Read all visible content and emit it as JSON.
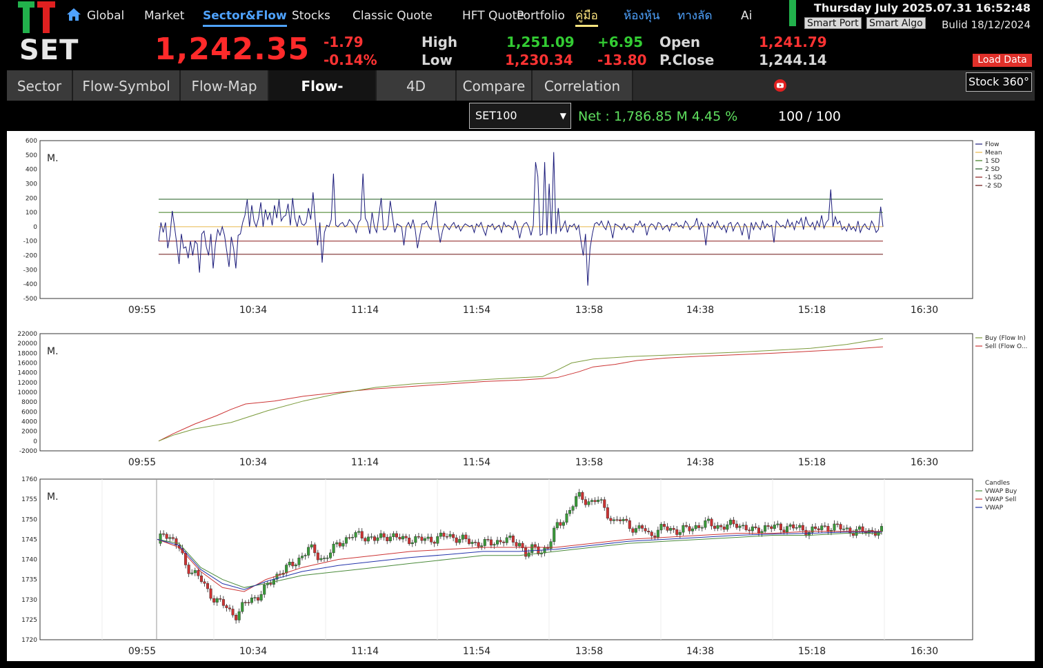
{
  "brand": {
    "tt": "TT",
    "set": "SET"
  },
  "nav": [
    {
      "label": "Global"
    },
    {
      "label": "Market"
    },
    {
      "label": "Sector&Flow"
    },
    {
      "label": "Stocks"
    },
    {
      "label": "Classic Quote"
    },
    {
      "label": "HFT Quote"
    },
    {
      "label": "Portfolio"
    },
    {
      "label": "คู่มือ"
    },
    {
      "label": "ห้องหุ้น"
    },
    {
      "label": "ทางลัด"
    },
    {
      "label": "Ai"
    }
  ],
  "header": {
    "datetime": "Thursday July 2025.07.31 16:52:48",
    "smart_port": "Smart Port",
    "smart_algo": "Smart Algo",
    "build": "Bulid 18/12/2024",
    "load_data": "Load Data"
  },
  "index": {
    "price": "1,242.35",
    "change": "-1.79",
    "change_pct": "-0.14%",
    "high_label": "High",
    "high": "1,251.09",
    "high_diff": "+6.95",
    "low_label": "Low",
    "low": "1,230.34",
    "low_diff": "-13.80",
    "open_label": "Open",
    "open": "1,241.79",
    "pclose_label": "P.Close",
    "pclose": "1,244.14"
  },
  "tabs": [
    {
      "label": "Sector"
    },
    {
      "label": "Flow-Symbol"
    },
    {
      "label": "Flow-Map"
    },
    {
      "label": "Flow-IntraDay"
    },
    {
      "label": "4D"
    },
    {
      "label": "Compare"
    },
    {
      "label": "Correlation"
    }
  ],
  "stock360": "Stock 360°",
  "filter": {
    "selected": "SET100",
    "net": "Net : 1,786.85 M",
    "net_pct": "4.45 %",
    "count": "100 / 100"
  },
  "colors": {
    "flow": "#1a1a7a",
    "mean": "#e8b84a",
    "sd1": "#3a7a1a",
    "sd2": "#1e5a1e",
    "neg_sd1": "#8a1a1a",
    "neg_sd2": "#6a1010",
    "buy": "#7a9a3a",
    "sell": "#cc3333",
    "vwap_buy": "#4a8a3a",
    "vwap_sell": "#cc3333",
    "vwap": "#2233aa",
    "candle_up": "#3a9a3a",
    "candle_down": "#cc3333"
  },
  "chart_data": [
    {
      "type": "line",
      "unit_label": "M.",
      "x_ticks": [
        "09:55",
        "10:34",
        "11:14",
        "11:54",
        "13:58",
        "14:38",
        "15:18",
        "16:30"
      ],
      "y_ticks": [
        600,
        500,
        400,
        300,
        200,
        100,
        0,
        -100,
        -200,
        -300,
        -400,
        -500
      ],
      "ylim": [
        -500,
        600
      ],
      "legend": [
        "Flow",
        "Mean",
        "1 SD",
        "2 SD",
        "-1 SD",
        "-2 SD"
      ],
      "legend_position": "right",
      "mean": 0,
      "sd1": 100,
      "sd2": 192,
      "neg_sd1": -100,
      "neg_sd2": -192,
      "flow_values": [
        -100,
        30,
        -40,
        30,
        -150,
        -60,
        110,
        0,
        -120,
        -260,
        -50,
        -150,
        -140,
        -220,
        -100,
        -200,
        -100,
        -120,
        -320,
        -50,
        -30,
        -140,
        -200,
        -50,
        -290,
        -120,
        -20,
        -60,
        0,
        -60,
        -170,
        -280,
        -70,
        -150,
        -290,
        -60,
        -50,
        30,
        80,
        190,
        0,
        150,
        40,
        0,
        60,
        170,
        0,
        120,
        50,
        100,
        10,
        150,
        60,
        190,
        40,
        70,
        80,
        160,
        10,
        200,
        60,
        0,
        80,
        20,
        10,
        30,
        130,
        50,
        240,
        40,
        -130,
        30,
        -250,
        -40,
        10,
        0,
        50,
        370,
        10,
        0,
        20,
        30,
        0,
        10,
        50,
        30,
        10,
        -40,
        30,
        50,
        370,
        60,
        30,
        -50,
        100,
        0,
        -40,
        80,
        200,
        -20,
        -20,
        10,
        180,
        70,
        -40,
        20,
        10,
        0,
        -130,
        0,
        30,
        -10,
        50,
        -20,
        -150,
        -60,
        20,
        20,
        40,
        0,
        -20,
        80,
        180,
        -10,
        -110,
        -30,
        20,
        0,
        -20,
        10,
        30,
        -10,
        10,
        -30,
        0,
        20,
        10,
        0,
        10,
        -40,
        20,
        0,
        30,
        -20,
        -60,
        10,
        0,
        20,
        -20,
        0,
        10,
        -40,
        30,
        0,
        10,
        0,
        -20,
        40,
        0,
        -80,
        -10,
        20,
        30,
        0,
        -60,
        10,
        450,
        350,
        -60,
        -50,
        450,
        -60,
        300,
        -50,
        520,
        -50,
        130,
        -30,
        0,
        40,
        -40,
        10,
        0,
        20,
        -20,
        10,
        -100,
        -200,
        -50,
        -410,
        -150,
        -50,
        20,
        30,
        10,
        40,
        0,
        -20,
        40,
        0,
        -80,
        20,
        10,
        0,
        -20,
        20,
        -20,
        0,
        -10,
        -40,
        20,
        10,
        40,
        0,
        20,
        -60,
        0,
        20,
        10,
        -20,
        30,
        20,
        -20,
        0,
        10,
        -30,
        20,
        10,
        30,
        0,
        10,
        -10,
        40,
        20,
        -20,
        0,
        10,
        60,
        -20,
        30,
        0,
        -130,
        20,
        0,
        30,
        -10,
        40,
        0,
        -20,
        10,
        -40,
        20,
        30,
        -30,
        10,
        30,
        0,
        -60,
        20,
        0,
        -90,
        30,
        -20,
        30,
        0,
        -20,
        40,
        -10,
        20,
        0,
        10,
        -110,
        40,
        20,
        0,
        10,
        -10,
        50,
        0,
        30,
        -20,
        40,
        20,
        60,
        -20,
        70,
        20,
        0,
        30,
        -20,
        40,
        0,
        80,
        -10,
        30,
        50,
        260,
        0,
        70,
        20,
        40,
        -20,
        0,
        -30,
        20,
        -20,
        0,
        -30,
        40,
        -40,
        0,
        20,
        -10,
        -20,
        40,
        10,
        -40,
        -20,
        140,
        0
      ]
    },
    {
      "type": "line",
      "unit_label": "M.",
      "x_ticks": [
        "09:55",
        "10:34",
        "11:14",
        "11:54",
        "13:58",
        "14:38",
        "15:18",
        "16:30"
      ],
      "y_ticks": [
        22000,
        20000,
        18000,
        16000,
        14000,
        12000,
        10000,
        8000,
        6000,
        4000,
        2000,
        0,
        -2000
      ],
      "ylim": [
        -2000,
        22000
      ],
      "legend": [
        "Buy (Flow In)",
        "Sell (Flow O..."
      ],
      "legend_position": "right",
      "buy_points": [
        [
          0,
          0
        ],
        [
          0.02,
          1200
        ],
        [
          0.05,
          2500
        ],
        [
          0.1,
          3800
        ],
        [
          0.15,
          6200
        ],
        [
          0.2,
          8200
        ],
        [
          0.25,
          9800
        ],
        [
          0.3,
          11000
        ],
        [
          0.35,
          11700
        ],
        [
          0.4,
          12100
        ],
        [
          0.45,
          12600
        ],
        [
          0.5,
          13000
        ],
        [
          0.53,
          13200
        ],
        [
          0.55,
          14500
        ],
        [
          0.57,
          16000
        ],
        [
          0.6,
          16800
        ],
        [
          0.65,
          17300
        ],
        [
          0.7,
          17600
        ],
        [
          0.75,
          17900
        ],
        [
          0.8,
          18200
        ],
        [
          0.85,
          18600
        ],
        [
          0.9,
          19000
        ],
        [
          0.95,
          19800
        ],
        [
          1.0,
          21000
        ]
      ],
      "sell_points": [
        [
          0,
          0
        ],
        [
          0.02,
          1500
        ],
        [
          0.05,
          3500
        ],
        [
          0.08,
          5200
        ],
        [
          0.1,
          6500
        ],
        [
          0.12,
          7600
        ],
        [
          0.16,
          8200
        ],
        [
          0.2,
          9200
        ],
        [
          0.25,
          10000
        ],
        [
          0.3,
          10700
        ],
        [
          0.35,
          11200
        ],
        [
          0.4,
          11700
        ],
        [
          0.45,
          12200
        ],
        [
          0.5,
          12500
        ],
        [
          0.55,
          13000
        ],
        [
          0.58,
          14200
        ],
        [
          0.6,
          15200
        ],
        [
          0.63,
          15700
        ],
        [
          0.66,
          16500
        ],
        [
          0.7,
          17000
        ],
        [
          0.75,
          17400
        ],
        [
          0.8,
          17700
        ],
        [
          0.85,
          18000
        ],
        [
          0.9,
          18400
        ],
        [
          0.95,
          18800
        ],
        [
          1.0,
          19300
        ]
      ]
    },
    {
      "type": "line",
      "unit_label": "M.",
      "x_ticks": [
        "09:55",
        "10:34",
        "11:14",
        "11:54",
        "13:58",
        "14:38",
        "15:18",
        "16:30"
      ],
      "y_ticks": [
        1760,
        1755,
        1750,
        1745,
        1740,
        1735,
        1730,
        1725,
        1720
      ],
      "ylim": [
        1720,
        1760
      ],
      "legend": [
        "Candles",
        "VWAP Buy",
        "VWAP Sell",
        "VWAP"
      ],
      "legend_position": "right",
      "price_path": [
        [
          0,
          1744
        ],
        [
          0.01,
          1747
        ],
        [
          0.02,
          1745
        ],
        [
          0.03,
          1743
        ],
        [
          0.04,
          1738
        ],
        [
          0.05,
          1737
        ],
        [
          0.06,
          1735
        ],
        [
          0.07,
          1732
        ],
        [
          0.08,
          1730
        ],
        [
          0.09,
          1729
        ],
        [
          0.1,
          1727
        ],
        [
          0.11,
          1726
        ],
        [
          0.12,
          1729
        ],
        [
          0.13,
          1730
        ],
        [
          0.14,
          1731
        ],
        [
          0.15,
          1733
        ],
        [
          0.16,
          1735
        ],
        [
          0.17,
          1737
        ],
        [
          0.18,
          1738
        ],
        [
          0.19,
          1739
        ],
        [
          0.2,
          1741
        ],
        [
          0.21,
          1743
        ],
        [
          0.22,
          1741
        ],
        [
          0.23,
          1740
        ],
        [
          0.24,
          1742
        ],
        [
          0.25,
          1744
        ],
        [
          0.26,
          1745
        ],
        [
          0.27,
          1746
        ],
        [
          0.28,
          1746
        ],
        [
          0.3,
          1745
        ],
        [
          0.32,
          1746
        ],
        [
          0.34,
          1745
        ],
        [
          0.36,
          1745
        ],
        [
          0.38,
          1745
        ],
        [
          0.4,
          1746
        ],
        [
          0.42,
          1745
        ],
        [
          0.44,
          1744
        ],
        [
          0.46,
          1744
        ],
        [
          0.48,
          1745
        ],
        [
          0.5,
          1744
        ],
        [
          0.51,
          1741
        ],
        [
          0.52,
          1743
        ],
        [
          0.53,
          1742
        ],
        [
          0.54,
          1743
        ],
        [
          0.55,
          1748
        ],
        [
          0.56,
          1750
        ],
        [
          0.57,
          1752
        ],
        [
          0.58,
          1756
        ],
        [
          0.59,
          1755
        ],
        [
          0.6,
          1754
        ],
        [
          0.61,
          1755
        ],
        [
          0.62,
          1752
        ],
        [
          0.63,
          1749
        ],
        [
          0.64,
          1750
        ],
        [
          0.65,
          1749
        ],
        [
          0.66,
          1747
        ],
        [
          0.67,
          1748
        ],
        [
          0.68,
          1746
        ],
        [
          0.7,
          1748
        ],
        [
          0.72,
          1747
        ],
        [
          0.74,
          1748
        ],
        [
          0.76,
          1749
        ],
        [
          0.78,
          1748
        ],
        [
          0.8,
          1749
        ],
        [
          0.82,
          1747
        ],
        [
          0.84,
          1748
        ],
        [
          0.86,
          1748
        ],
        [
          0.88,
          1748
        ],
        [
          0.9,
          1747
        ],
        [
          0.92,
          1748
        ],
        [
          0.94,
          1748
        ],
        [
          0.96,
          1747
        ],
        [
          0.98,
          1747
        ],
        [
          1.0,
          1747
        ]
      ],
      "vwap_buy_points": [
        [
          0,
          1745
        ],
        [
          0.03,
          1744
        ],
        [
          0.06,
          1738
        ],
        [
          0.09,
          1735
        ],
        [
          0.12,
          1733
        ],
        [
          0.15,
          1734
        ],
        [
          0.2,
          1736
        ],
        [
          0.25,
          1737
        ],
        [
          0.3,
          1738
        ],
        [
          0.35,
          1739
        ],
        [
          0.4,
          1740
        ],
        [
          0.45,
          1741
        ],
        [
          0.5,
          1741
        ],
        [
          0.55,
          1742
        ],
        [
          0.6,
          1743
        ],
        [
          0.65,
          1744
        ],
        [
          0.7,
          1744.5
        ],
        [
          0.75,
          1745
        ],
        [
          0.8,
          1745.5
        ],
        [
          0.85,
          1746
        ],
        [
          0.9,
          1746
        ],
        [
          0.95,
          1746.5
        ],
        [
          1.0,
          1746.5
        ]
      ],
      "vwap_sell_points": [
        [
          0,
          1745
        ],
        [
          0.03,
          1743
        ],
        [
          0.06,
          1737
        ],
        [
          0.09,
          1733
        ],
        [
          0.12,
          1732
        ],
        [
          0.15,
          1735
        ],
        [
          0.2,
          1738
        ],
        [
          0.25,
          1740
        ],
        [
          0.3,
          1741
        ],
        [
          0.35,
          1742
        ],
        [
          0.4,
          1742.5
        ],
        [
          0.45,
          1743
        ],
        [
          0.5,
          1743
        ],
        [
          0.55,
          1743
        ],
        [
          0.6,
          1744
        ],
        [
          0.65,
          1745
        ],
        [
          0.7,
          1745.5
        ],
        [
          0.75,
          1746
        ],
        [
          0.8,
          1746.5
        ],
        [
          0.85,
          1746.5
        ],
        [
          0.9,
          1747
        ],
        [
          0.95,
          1747
        ],
        [
          1.0,
          1747
        ]
      ],
      "vwap_points": [
        [
          0,
          1745
        ],
        [
          0.03,
          1743.5
        ],
        [
          0.06,
          1737.5
        ],
        [
          0.09,
          1734
        ],
        [
          0.12,
          1732.5
        ],
        [
          0.15,
          1734.5
        ],
        [
          0.2,
          1737
        ],
        [
          0.25,
          1738.5
        ],
        [
          0.3,
          1739.5
        ],
        [
          0.35,
          1740.5
        ],
        [
          0.4,
          1741.2
        ],
        [
          0.45,
          1742
        ],
        [
          0.5,
          1742
        ],
        [
          0.55,
          1742.5
        ],
        [
          0.6,
          1743.5
        ],
        [
          0.65,
          1744.5
        ],
        [
          0.7,
          1745
        ],
        [
          0.75,
          1745.5
        ],
        [
          0.8,
          1746
        ],
        [
          0.85,
          1746.3
        ],
        [
          0.9,
          1746.5
        ],
        [
          0.95,
          1746.8
        ],
        [
          1.0,
          1746.8
        ]
      ]
    }
  ]
}
